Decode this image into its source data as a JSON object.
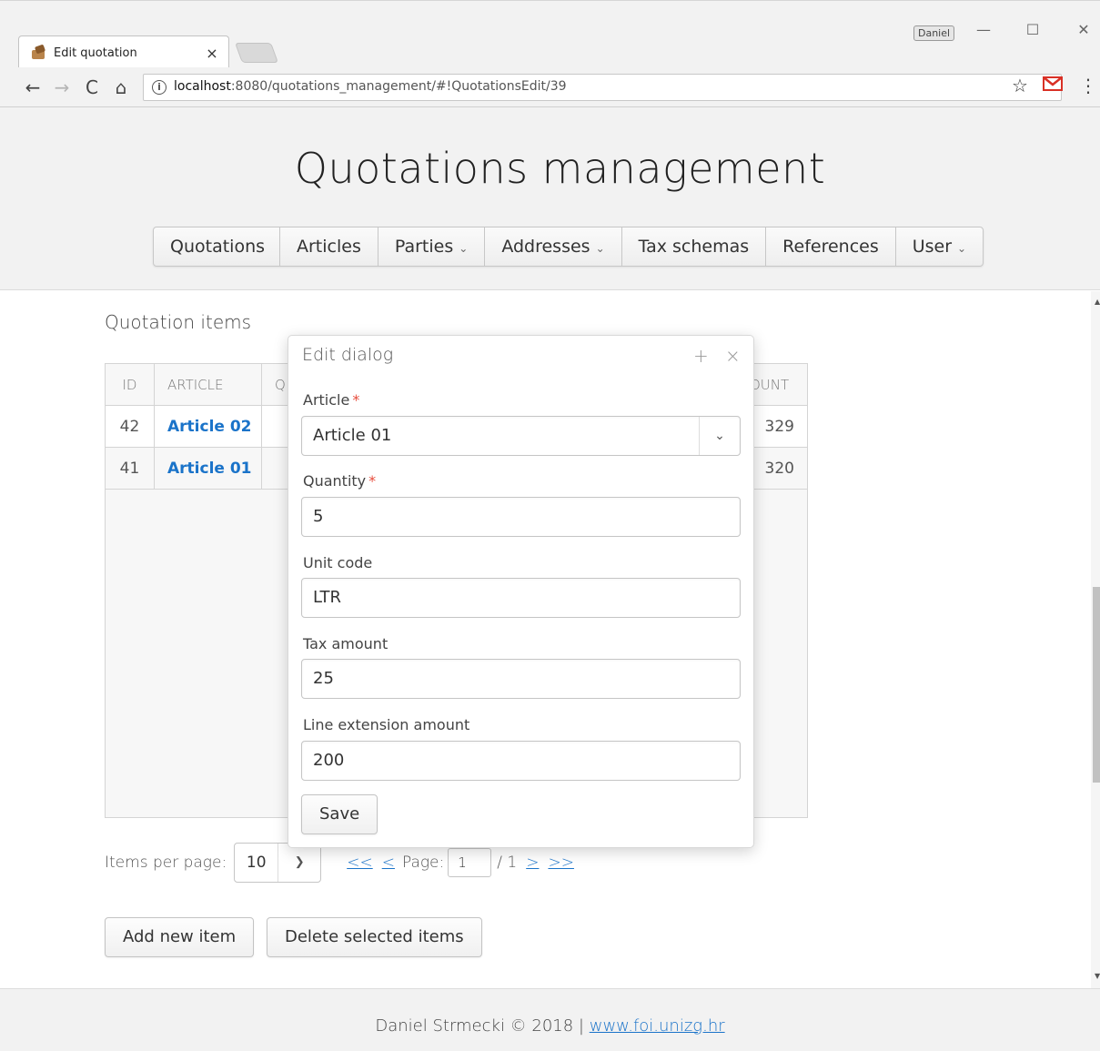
{
  "browser": {
    "tab_title": "Edit quotation",
    "tab_close": "×",
    "profile_name": "Daniel",
    "url_host": "localhost",
    "url_path": ":8080/quotations_management/#!QuotationsEdit/39",
    "window_min": "—",
    "window_max": "☐",
    "window_close": "✕"
  },
  "header": {
    "title": "Quotations management",
    "menu": [
      {
        "label": "Quotations",
        "dropdown": false
      },
      {
        "label": "Articles",
        "dropdown": false
      },
      {
        "label": "Parties",
        "dropdown": true
      },
      {
        "label": "Addresses",
        "dropdown": true
      },
      {
        "label": "Tax schemas",
        "dropdown": false
      },
      {
        "label": "References",
        "dropdown": false
      },
      {
        "label": "User",
        "dropdown": true
      }
    ]
  },
  "main": {
    "section_title": "Quotation items",
    "grid": {
      "columns": [
        "ID",
        "ARTICLE",
        "Q",
        "OUNT"
      ],
      "rows": [
        {
          "id": "42",
          "article": "Article 02",
          "amount": "329"
        },
        {
          "id": "41",
          "article": "Article 01",
          "amount": "320"
        }
      ]
    },
    "pager": {
      "items_per_page_label": "Items per page:",
      "items_per_page_value": "10",
      "first": "<<",
      "prev": "<",
      "page_label": "Page:",
      "page_value": "1",
      "page_total": "/ 1",
      "next": ">",
      "last": ">>"
    },
    "buttons": {
      "add": "Add new item",
      "delete": "Delete selected items"
    }
  },
  "dialog": {
    "title": "Edit dialog",
    "maximize": "+",
    "close": "×",
    "article_label": "Article",
    "article_value": "Article 01",
    "quantity_label": "Quantity",
    "quantity_value": "5",
    "unit_code_label": "Unit code",
    "unit_code_value": "LTR",
    "tax_amount_label": "Tax amount",
    "tax_amount_value": "25",
    "line_ext_label": "Line extension amount",
    "line_ext_value": "200",
    "required_mark": "*",
    "save": "Save"
  },
  "footer": {
    "text": "Daniel Strmecki © 2018 | ",
    "link": "www.foi.unizg.hr"
  },
  "colors": {
    "link": "#1a73c9",
    "required": "#e74c3c",
    "header_bg": "#f2f2f2"
  }
}
